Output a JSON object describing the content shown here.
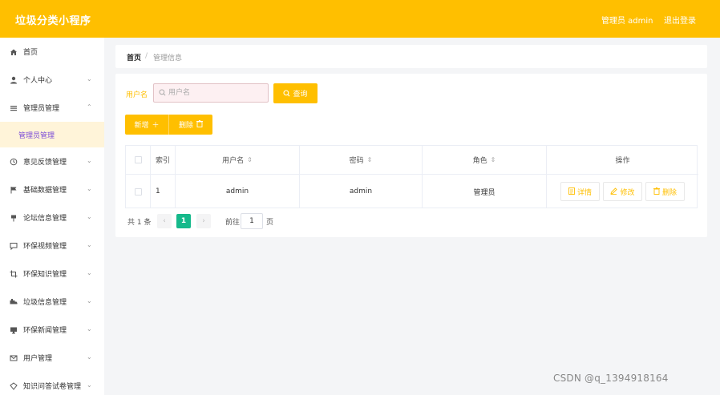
{
  "header": {
    "title": "垃圾分类小程序",
    "user": "管理员 admin",
    "logout": "退出登录",
    "bg_color": "#ffbf00"
  },
  "sidebar": {
    "items": [
      {
        "label": "首页",
        "icon": "home-icon"
      },
      {
        "label": "个人中心",
        "icon": "user-icon",
        "expandable": true
      },
      {
        "label": "管理员管理",
        "icon": "list-icon",
        "expandable": true,
        "expanded": true,
        "children": [
          {
            "label": "管理员管理",
            "active": true
          }
        ]
      },
      {
        "label": "意见反馈管理",
        "icon": "clock-icon",
        "expandable": true
      },
      {
        "label": "基础数据管理",
        "icon": "flag-icon",
        "expandable": true
      },
      {
        "label": "论坛信息管理",
        "icon": "pin-icon",
        "expandable": true
      },
      {
        "label": "环保视频管理",
        "icon": "chat-icon",
        "expandable": true
      },
      {
        "label": "环保知识管理",
        "icon": "crop-icon",
        "expandable": true
      },
      {
        "label": "垃圾信息管理",
        "icon": "truck-icon",
        "expandable": true
      },
      {
        "label": "环保新闻管理",
        "icon": "monitor-icon",
        "expandable": true
      },
      {
        "label": "用户管理",
        "icon": "mail-icon",
        "expandable": true
      },
      {
        "label": "知识问答试卷管理",
        "icon": "doc-icon",
        "expandable": true
      }
    ]
  },
  "breadcrumb": {
    "home": "首页",
    "separator": "/",
    "current": "管理信息"
  },
  "search": {
    "label": "用户名",
    "placeholder": "用户名",
    "value": "",
    "query_label": "查询"
  },
  "actions": {
    "add_label": "新增",
    "delete_label": "删除"
  },
  "table": {
    "columns": [
      "索引",
      "用户名",
      "密码",
      "角色",
      "操作"
    ],
    "rows": [
      {
        "index": "1",
        "username": "admin",
        "password": "admin",
        "role": "管理员"
      }
    ],
    "row_actions": {
      "detail": "详情",
      "edit": "修改",
      "delete": "删除"
    }
  },
  "pagination": {
    "total": "共 1 条",
    "prev": "‹",
    "current": "1",
    "next": "›",
    "goto_label": "前往",
    "goto_value": "1",
    "unit": "页"
  },
  "watermark": "CSDN @q_1394918164",
  "colors": {
    "accent": "#ffbf00",
    "active_page": "#16b98b",
    "active_sub_text": "#7b4dd8"
  }
}
